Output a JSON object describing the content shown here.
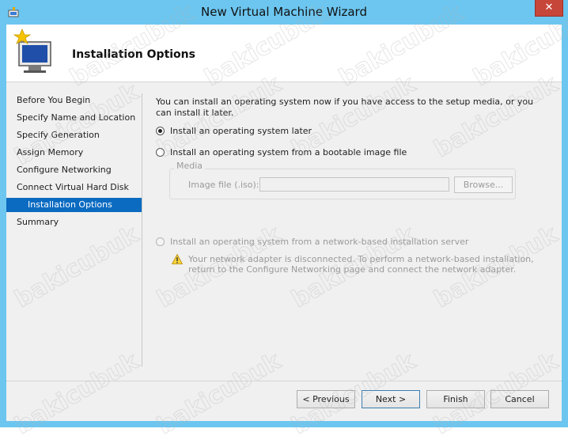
{
  "window": {
    "title": "New Virtual Machine Wizard",
    "close_glyph": "✕"
  },
  "header": {
    "title": "Installation Options",
    "icon": "new-vm-wizard-icon"
  },
  "nav": {
    "items": [
      {
        "label": "Before You Begin"
      },
      {
        "label": "Specify Name and Location"
      },
      {
        "label": "Specify Generation"
      },
      {
        "label": "Assign Memory"
      },
      {
        "label": "Configure Networking"
      },
      {
        "label": "Connect Virtual Hard Disk"
      },
      {
        "label": "Installation Options",
        "selected": true
      },
      {
        "label": "Summary"
      }
    ]
  },
  "content": {
    "description": "You can install an operating system now if you have access to the setup media, or you can install it later.",
    "options": {
      "later": {
        "label": "Install an operating system later",
        "checked": true
      },
      "image": {
        "label": "Install an operating system from a bootable image file",
        "checked": false
      },
      "network": {
        "label": "Install an operating system from a network-based installation server",
        "checked": false,
        "disabled": true
      }
    },
    "media": {
      "legend": "Media",
      "iso_label": "Image file (.iso):",
      "iso_value": "",
      "browse_label": "Browse..."
    },
    "warning": {
      "icon": "warning-triangle-icon",
      "text": "Your network adapter is disconnected. To perform a network-based installation, return to the Configure Networking page and connect the network adapter."
    }
  },
  "buttons": {
    "previous": "< Previous",
    "next": "Next >",
    "finish": "Finish",
    "cancel": "Cancel"
  },
  "watermark": "bakicubuk"
}
